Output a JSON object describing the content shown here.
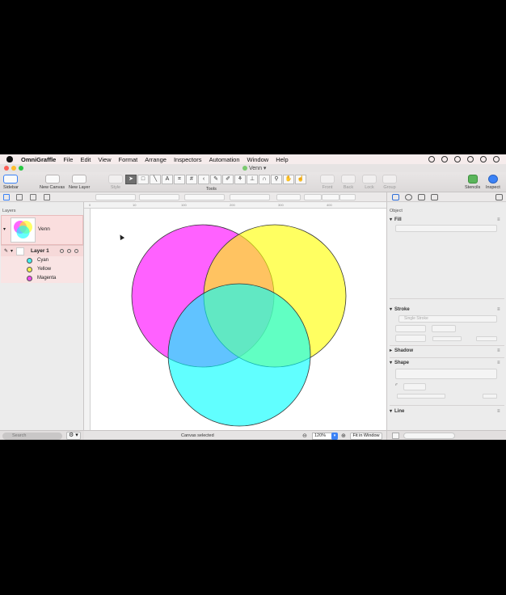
{
  "menubar": {
    "app_name": "OmniGraffle",
    "items": [
      "File",
      "Edit",
      "View",
      "Format",
      "Arrange",
      "Inspectors",
      "Automation",
      "Window",
      "Help"
    ]
  },
  "window": {
    "title": "Venn"
  },
  "toolbar": {
    "sidebar_label": "Sidebar",
    "new_canvas_label": "New Canvas",
    "new_layer_label": "New Layer",
    "style_label": "Style",
    "tools_label": "Tools",
    "front_label": "Front",
    "back_label": "Back",
    "lock_label": "Lock",
    "group_label": "Group",
    "stencils_label": "Stencils",
    "inspect_label": "Inspect"
  },
  "sidebar": {
    "title": "Layers",
    "canvas_name": "Venn",
    "layer_name": "Layer 1",
    "objects": [
      {
        "label": "Cyan",
        "color": "#44f0f0"
      },
      {
        "label": "Yellow",
        "color": "#f2f04a"
      },
      {
        "label": "Magenta",
        "color": "#f24af0"
      }
    ],
    "search_placeholder": "Search"
  },
  "ruler": {
    "ticks": [
      "0",
      "10",
      "100",
      "200",
      "300",
      "400"
    ]
  },
  "status": {
    "text": "Canvas selected",
    "zoom": "120%",
    "fit_label": "Fit in Window"
  },
  "inspector": {
    "title": "Object",
    "sections": {
      "fill": "Fill",
      "stroke": "Stroke",
      "stroke_type": "Single Stroke",
      "shadow": "Shadow",
      "shape": "Shape",
      "line": "Line"
    }
  },
  "colors": {
    "magenta": "#ff00ff",
    "yellow": "#ffff00",
    "cyan": "#00ffff",
    "accent": "#3b82f6"
  }
}
